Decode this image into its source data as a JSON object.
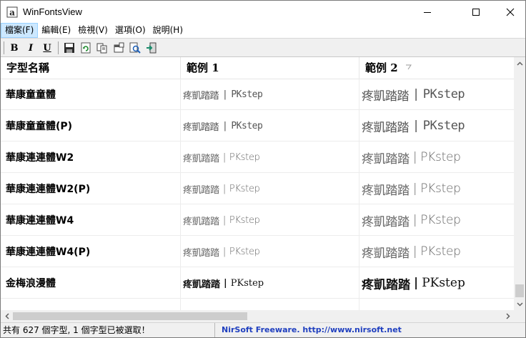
{
  "window": {
    "title": "WinFontsView"
  },
  "menu": [
    {
      "label": "檔案(F)"
    },
    {
      "label": "編輯(E)"
    },
    {
      "label": "檢視(V)"
    },
    {
      "label": "選項(O)"
    },
    {
      "label": "說明(H)"
    }
  ],
  "toolbar": {
    "bold": "B",
    "italic": "I",
    "underline": "U",
    "icons": [
      "save-icon",
      "refresh-icon",
      "copy-icon",
      "properties-icon",
      "find-icon",
      "exit-icon"
    ]
  },
  "columns": {
    "name": "字型名稱",
    "sample1": "範例 1",
    "sample2": "範例 2"
  },
  "rows": [
    {
      "name": "華康童童體",
      "cjk": "疼凱踏踏",
      "latin": "PKstep"
    },
    {
      "name": "華康童童體(P)",
      "cjk": "疼凱踏踏",
      "latin": "PKstep"
    },
    {
      "name": "華康連連體W2",
      "cjk": "疼凱踏踏",
      "latin": "PKstep"
    },
    {
      "name": "華康連連體W2(P)",
      "cjk": "疼凱踏踏",
      "latin": "PKstep"
    },
    {
      "name": "華康連連體W4",
      "cjk": "疼凱踏踏",
      "latin": "PKstep"
    },
    {
      "name": "華康連連體W4(P)",
      "cjk": "疼凱踏踏",
      "latin": "PKstep"
    },
    {
      "name": "金梅浪漫體",
      "cjk": "疼凱踏踏",
      "latin": "PKstep"
    }
  ],
  "status": {
    "count": "共有 627 個字型, 1 個字型已被選取！",
    "credit": "NirSoft Freeware.  http://www.nirsoft.net"
  },
  "colors": {
    "accent_link": "#1f3fbf",
    "menu_highlight": "#cce8ff"
  }
}
